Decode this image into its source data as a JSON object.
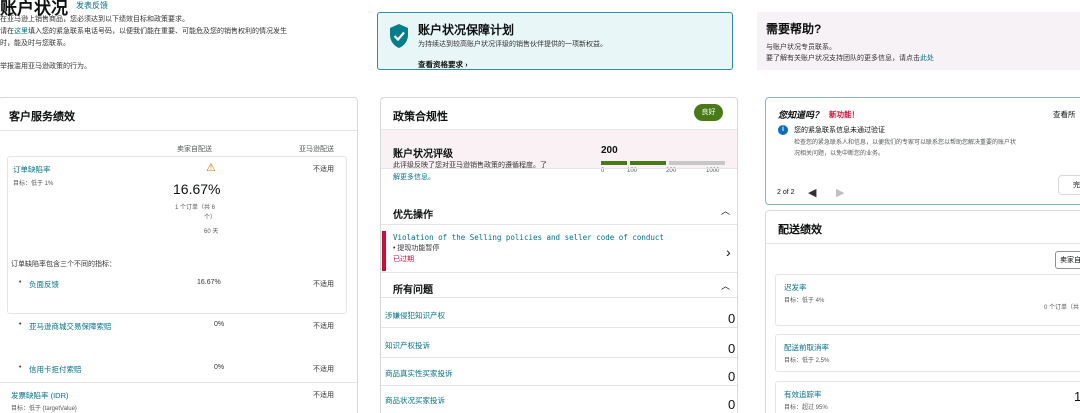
{
  "intro": {
    "title": "账户状况",
    "feedback": "发表反馈",
    "line1": "在亚马逊上销售商品，您必须达到以下绩效目标和政策要求。",
    "line2_pre": "请在",
    "line2_link": "这里",
    "line2_post": "填入您的紧急联系电话号码，以便我们能在重要、可能危及您的销售权利的情况发生",
    "line3": "时，能及时与您联系。",
    "link4": "举报滥用亚马逊政策的行为。"
  },
  "protection": {
    "title": "账户状况保障计划",
    "desc": "为持续达到较高账户状况评级的销售伙伴提供的一项新权益。",
    "link": "查看资格要求"
  },
  "help": {
    "title": "需要帮助?",
    "line1": "与账户状况专员联系。",
    "line2_pre": "要了解有关账户状况支持团队的更多信息，请点击",
    "line2_link": "此处"
  },
  "customer": {
    "title": "客户服务绩效",
    "col1": "卖家自配送",
    "col2": "亚马逊配送",
    "odr": {
      "name": "订单缺陷率",
      "target": "目标：低于 1%",
      "value": "16.67%",
      "sub1": "1 个订单（共 6",
      "sub2": "个）",
      "sub3": "60 天",
      "fba": "不适用"
    },
    "intro": "订单缺陷率包含三个不同的指标：",
    "items": [
      {
        "name": "负面反馈",
        "v1": "16.67%",
        "v2": "不适用"
      },
      {
        "name": "亚马逊商城交易保障索赔",
        "v1": "0%",
        "v2": "不适用"
      },
      {
        "name": "信用卡拒付索赔",
        "v1": "0%",
        "v2": "不适用"
      }
    ],
    "idr": {
      "name": "发票缺陷率 (IDR)",
      "target": "目标：低于 {targetValue}",
      "v2": "不适用"
    }
  },
  "policy": {
    "title": "政策合规性",
    "badge": "良好",
    "rating_title": "账户状况评级",
    "rating_desc1": "此评级反映了您对亚马逊销售政策的遵循程度。了",
    "rating_desc2": "解更多信息。",
    "score": "200",
    "ticks": [
      "0",
      "100",
      "200",
      "1000"
    ],
    "priority_title": "优先操作",
    "violation": "Violation of the Selling policies and seller code of conduct",
    "violation_sub": "• 提现功能暂停",
    "overdue": "已过期",
    "issues_title": "所有问题",
    "issues": [
      {
        "name": "涉嫌侵犯知识产权",
        "count": "0"
      },
      {
        "name": "知识产权投诉",
        "count": "0"
      },
      {
        "name": "商品真实性买家投诉",
        "count": "0"
      },
      {
        "name": "商品状况买家投诉",
        "count": "0"
      }
    ]
  },
  "notice": {
    "title": "您知道吗？",
    "new": "新功能！",
    "viewall": "查看所",
    "head": "您的紧急联系信息未通过验证",
    "body1": "检查您的紧急联系人和信息，以便我们的专家可以联系您以帮助您解决重要的账户状",
    "body2": "况相关问题，以免中断您的业务。",
    "pager": "2 of 2",
    "btn": "完"
  },
  "shipping": {
    "title": "配送绩效",
    "col": "卖家自",
    "rows": [
      {
        "name": "迟发率",
        "target": "目标：低于 4%",
        "value": "0 个订单（共"
      },
      {
        "name": "配送前取消率",
        "target": "目标：低于 2.5%",
        "value": ""
      },
      {
        "name": "有效追踪率",
        "target": "目标：超过 95%",
        "value": "1"
      }
    ]
  }
}
